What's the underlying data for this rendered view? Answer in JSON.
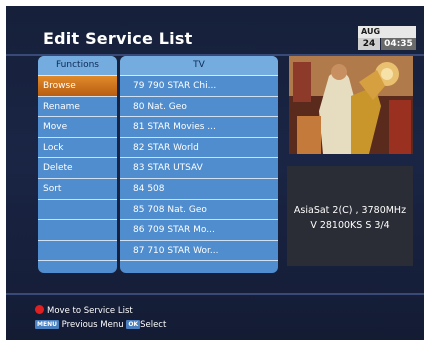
{
  "header": {
    "title": "Edit Service List",
    "clock": {
      "month": "AUG",
      "day": "24",
      "time": "04:35"
    }
  },
  "functions": {
    "header": "Functions",
    "items": [
      "Browse",
      "Rename",
      "Move",
      "Lock",
      "Delete",
      "Sort",
      "",
      "",
      "",
      ""
    ],
    "selected_index": 0
  },
  "channels": {
    "header": "TV",
    "items": [
      "79  790 STAR Chi...",
      "80  Nat. Geo",
      "81  STAR Movies ...",
      "82  STAR World",
      "83  STAR UTSAV",
      "84  508",
      "85  708 Nat. Geo",
      "86  709 STAR Mo...",
      "87  710 STAR Wor..."
    ]
  },
  "info": {
    "line1": "AsiaSat 2(C) , 3780MHz",
    "line2": "V 28100KS S 3/4"
  },
  "footer": {
    "hint1": "Move to Service List",
    "menu_key": "MENU",
    "menu_label": "Previous Menu",
    "ok_key": "OK",
    "ok_label": "Select"
  },
  "colors": {
    "background": "#16203a",
    "list_blue": "#4f8dcf",
    "selection_orange": "#e08a2a",
    "red_button": "#e02020"
  }
}
